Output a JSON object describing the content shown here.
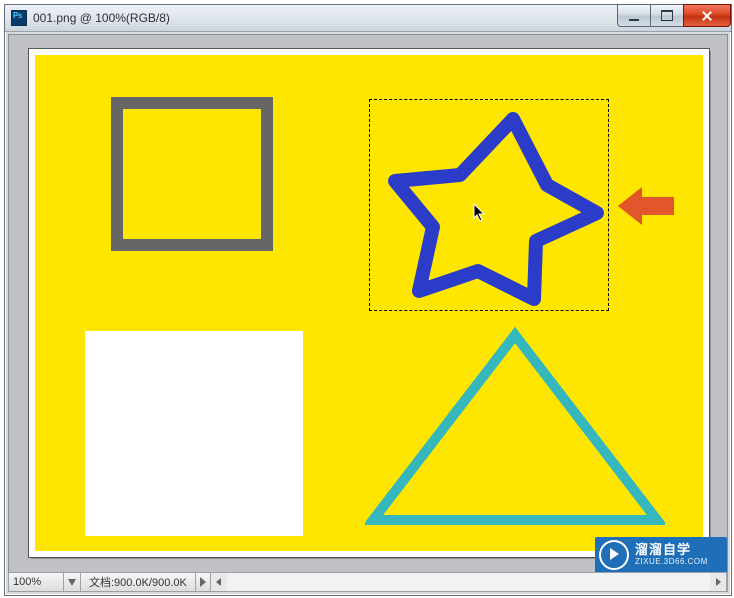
{
  "window": {
    "filename": "001.png",
    "zoom_label": "100%",
    "mode": "RGB/8",
    "title_full": "001.png @ 100%(RGB/8)"
  },
  "window_controls": {
    "minimize_tip": "Minimize",
    "maximize_tip": "Maximize",
    "close_tip": "Close"
  },
  "statusbar": {
    "zoom_value": "100%",
    "doc_size_label": "文档:900.0K/900.0K"
  },
  "watermark": {
    "main": "溜溜自学",
    "sub": "ZIXUE.3D66.COM"
  },
  "canvas": {
    "background": "#ffe600",
    "shapes": {
      "grey_square": {
        "stroke": "#666666",
        "fill": "none"
      },
      "white_rect": {
        "fill": "#ffffff"
      },
      "blue_star": {
        "stroke": "#2a3cc8",
        "fill": "none",
        "selected": true
      },
      "teal_triangle": {
        "stroke": "#34b7bd",
        "fill": "none"
      }
    },
    "annotation_arrow_color": "#e2562b"
  }
}
